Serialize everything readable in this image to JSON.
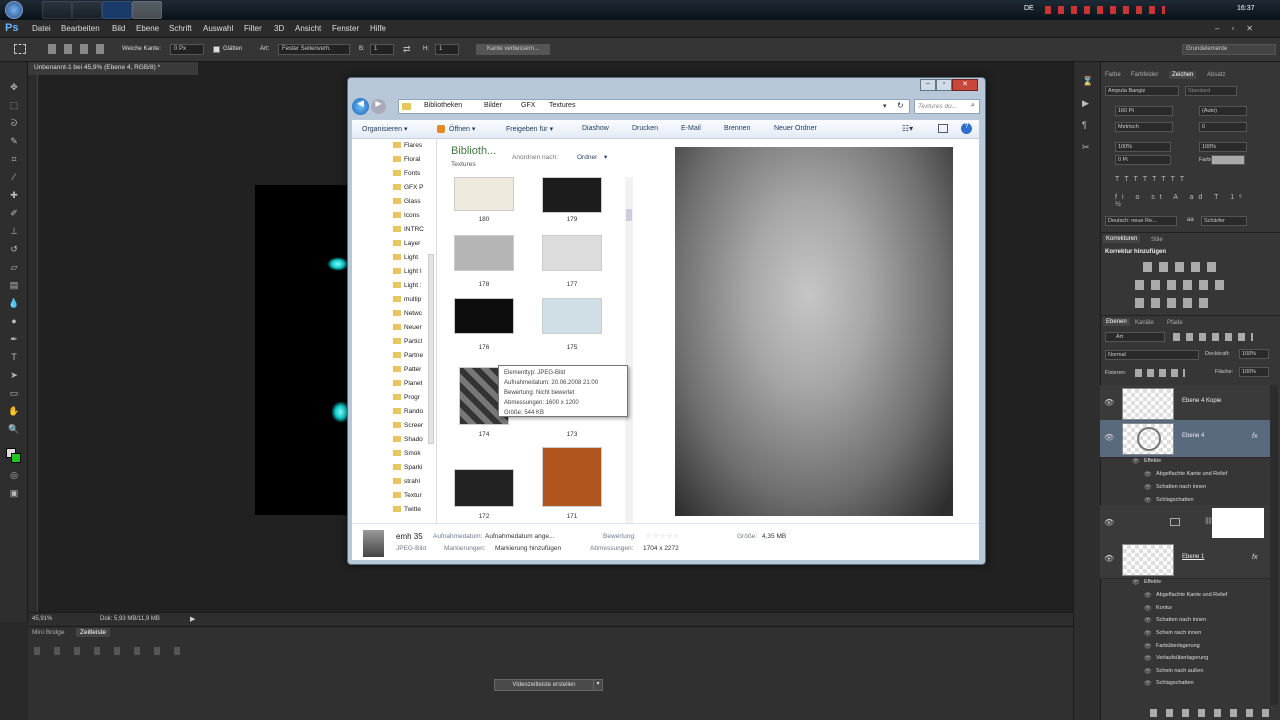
{
  "taskbar": {
    "lang": "DE",
    "clock": "16:37"
  },
  "menu": [
    "Datei",
    "Bearbeiten",
    "Bild",
    "Ebene",
    "Schrift",
    "Auswahl",
    "Filter",
    "3D",
    "Ansicht",
    "Fenster",
    "Hilfe"
  ],
  "ps_logo": "Ps",
  "options": {
    "feather_label": "Weiche Kante:",
    "feather_value": "0 Px",
    "smooth_label": "Glätten",
    "style_label": "Art:",
    "style_value": "Fester Seitenverh.",
    "width_label": "B:",
    "width_value": "1",
    "height_label": "H:",
    "height_value": "1",
    "refine_button": "Kante verbessern...",
    "workspace": "Grundelemente"
  },
  "document": {
    "tab": "Unbenannt-1 bei 45,9% (Ebene 4, RGB/8) *",
    "zoom": "45,91%",
    "doc_info": "Dok: 5,93 MB/11,9 MB"
  },
  "bottom_panel": {
    "tab_minibridge": "Mini Bridge",
    "tab_timeline": "Zeitleiste",
    "create_video_button": "Videozeitleiste erstellen"
  },
  "character_panel": {
    "tabs": [
      "Farbe",
      "Farbfelder",
      "Zeichen",
      "Absatz"
    ],
    "font_family": "Amputa Bangiz",
    "font_style": "Standard",
    "font_size": "160 Pt",
    "leading": "(Auto)",
    "kerning": "Metrisch",
    "tracking": "0",
    "vscale": "100%",
    "hscale": "100%",
    "baseline": "0 Pt",
    "color_label": "Farbe:",
    "language": "Deutsch: neue Re...",
    "aa_label": "aa",
    "aa": "Schärfer"
  },
  "adjustments_panel": {
    "tabs": [
      "Korrekturen",
      "Stile"
    ],
    "title": "Korrektur hinzufügen"
  },
  "layers_panel": {
    "tabs": [
      "Ebenen",
      "Kanäle",
      "Pfade"
    ],
    "filter": "Art",
    "blend_mode": "Normal",
    "opacity_label": "Deckkraft:",
    "opacity": "100%",
    "lock_label": "Fixieren:",
    "fill_label": "Fläche:",
    "fill": "100%",
    "layers": [
      {
        "name": "Ebene 4 Kopie"
      },
      {
        "name": "Ebene 4",
        "fx": "fx"
      },
      {
        "name": ""
      },
      {
        "name": "Ebene 1",
        "fx": "fx"
      }
    ],
    "effects_a": {
      "title": "Effekte",
      "items": [
        "Abgeflachte Kante und Relief",
        "Schatten nach innen",
        "Schlagschatten"
      ]
    },
    "effects_b": {
      "title": "Effekte",
      "items": [
        "Abgeflachte Kante und Relief",
        "Kontur",
        "Schatten nach innen",
        "Schein nach innen",
        "Farbüberlagerung",
        "Verlaufsüberlagerung",
        "Schein nach außen",
        "Schlagschatten"
      ]
    }
  },
  "explorer": {
    "breadcrumb": [
      "Bibliotheken",
      "Bilder",
      "GFX",
      "Textures"
    ],
    "search_placeholder": "Textures du...",
    "commands": [
      "Organisieren ▾",
      "Öffnen ▾",
      "Freigeben für ▾",
      "Diashow",
      "Drucken",
      "E-Mail",
      "Brennen",
      "Neuer Ordner"
    ],
    "folders": [
      "Flares",
      "Floral",
      "Fonts",
      "GFX P",
      "Glass",
      "Icons",
      "INTRC",
      "Layer",
      "Light",
      "Light I",
      "Light :",
      "multip",
      "Netwc",
      "Neuer",
      "Particl",
      "Partne",
      "Patter",
      "Planet",
      "Progr",
      "Rando",
      "Screer",
      "Shado",
      "Smok",
      "Sparki",
      "strahl",
      "Textur",
      "Twitte",
      "Vecto"
    ],
    "library_title": "Biblioth...",
    "library_sub": "Textures",
    "arrange_label": "Anordnen nach:",
    "arrange_value": "Ordner",
    "files": [
      {
        "num": "180",
        "color": "#eeeade"
      },
      {
        "num": "179",
        "color": "#1c1c1c"
      },
      {
        "num": "178",
        "color": "#b5b5b5"
      },
      {
        "num": "177",
        "color": "#dcdcdc"
      },
      {
        "num": "176",
        "color": "#0d0d0d"
      },
      {
        "num": "175",
        "color": "#cfdfe5"
      },
      {
        "num": "174",
        "color": "#555"
      },
      {
        "num": "173",
        "color": "#888"
      },
      {
        "num": "172",
        "color": "#222"
      },
      {
        "num": "171",
        "color": "#b0551e"
      }
    ],
    "tooltip": [
      "Elementtyp: JPEG-Bild",
      "Aufnahmedatum: 20.06.2008 21:00",
      "Bewertung: Nicht bewertet",
      "Abmessungen: 1600 x 1200",
      "Größe: 544 KB"
    ],
    "details": {
      "name": "emh 35",
      "type": "JPEG-Bild",
      "date_label": "Aufnahmedatum:",
      "date_value": "Aufnahmedatum ange...",
      "rating_label": "Bewertung:",
      "tags_label": "Markierungen:",
      "tags_value": "Markierung hinzufügen",
      "dims_label": "Abmessungen:",
      "dims_value": "1704 x 2272",
      "size_label": "Größe:",
      "size_value": "4,35 MB"
    }
  }
}
